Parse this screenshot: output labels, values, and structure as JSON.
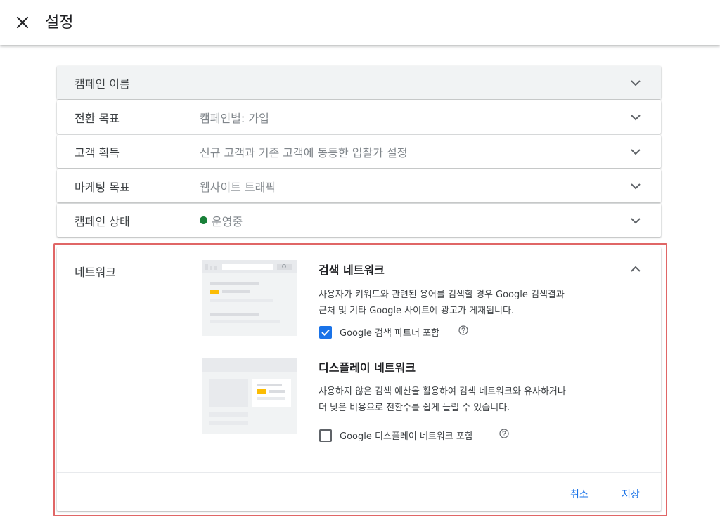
{
  "header": {
    "title": "설정",
    "close_icon": "close-icon"
  },
  "rows": [
    {
      "label": "캠페인 이름",
      "value": ""
    },
    {
      "label": "전환 목표",
      "value": "캠페인별: 가입"
    },
    {
      "label": "고객 획득",
      "value": "신규 고객과 기존 고객에 동등한 입찰가 설정"
    },
    {
      "label": "마케팅 목표",
      "value": "웹사이트 트래픽"
    },
    {
      "label": "캠페인 상태",
      "value": "운영중",
      "status_color": "#188038"
    }
  ],
  "network": {
    "label": "네트워크",
    "search": {
      "title": "검색 네트워크",
      "desc_line1": "사용자가 키워드와 관련된 용어를 검색할 경우 Google 검색결과",
      "desc_line2": "근처 및 기타 Google 사이트에 광고가 게재됩니다.",
      "checkbox_label": "Google 검색 파트너 포함",
      "checked": true
    },
    "display": {
      "title": "디스플레이 네트워크",
      "desc_line1": "사용하지 않은 검색 예산을 활용하여 검색 네트워크와 유사하거나",
      "desc_line2": "더 낮은 비용으로 전환수를 쉽게 늘릴 수 있습니다.",
      "checkbox_label": "Google 디스플레이 네트워크 포함",
      "checked": false
    },
    "cancel_label": "취소",
    "save_label": "저장"
  },
  "colors": {
    "accent": "#1a73e8",
    "highlight_border": "#e06666",
    "ad_yellow": "#fbbc04"
  }
}
